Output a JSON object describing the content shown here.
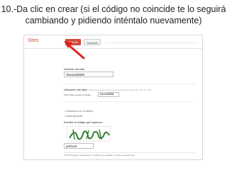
{
  "slide": {
    "title": "10.-Da clic en crear (si el código no coincide te lo seguirá cambiando y pidiendo inténtalo nuevamente)"
  },
  "app": {
    "brand": "Sites",
    "create_button": "CREAR",
    "cancel_button": "Cancelar"
  },
  "form": {
    "site_name_label": "Nombre del sitio:",
    "site_name_value": "Tareas58888",
    "location_label": "Ubicación del sitio",
    "location_hint": "- las URL solo pueden contener los siguientes caracteres: A-Z, a-z, 0-9",
    "location_prefix": "https://sites.google.com/site/",
    "location_value": "tareas58888",
    "theme_toggle": "▸ Selección de un diseño",
    "more_options_toggle": "▸ Más opciones",
    "captcha_label": "Escribe el código que aparece:",
    "captcha_value": "prehont"
  },
  "footer": {
    "text": "©2012 Google | Condiciones | Notificar uso indebido | Centro de asistencia"
  },
  "colors": {
    "brand": "#dd4b39",
    "create_button": "#d14836",
    "arrow": "#e02020"
  }
}
